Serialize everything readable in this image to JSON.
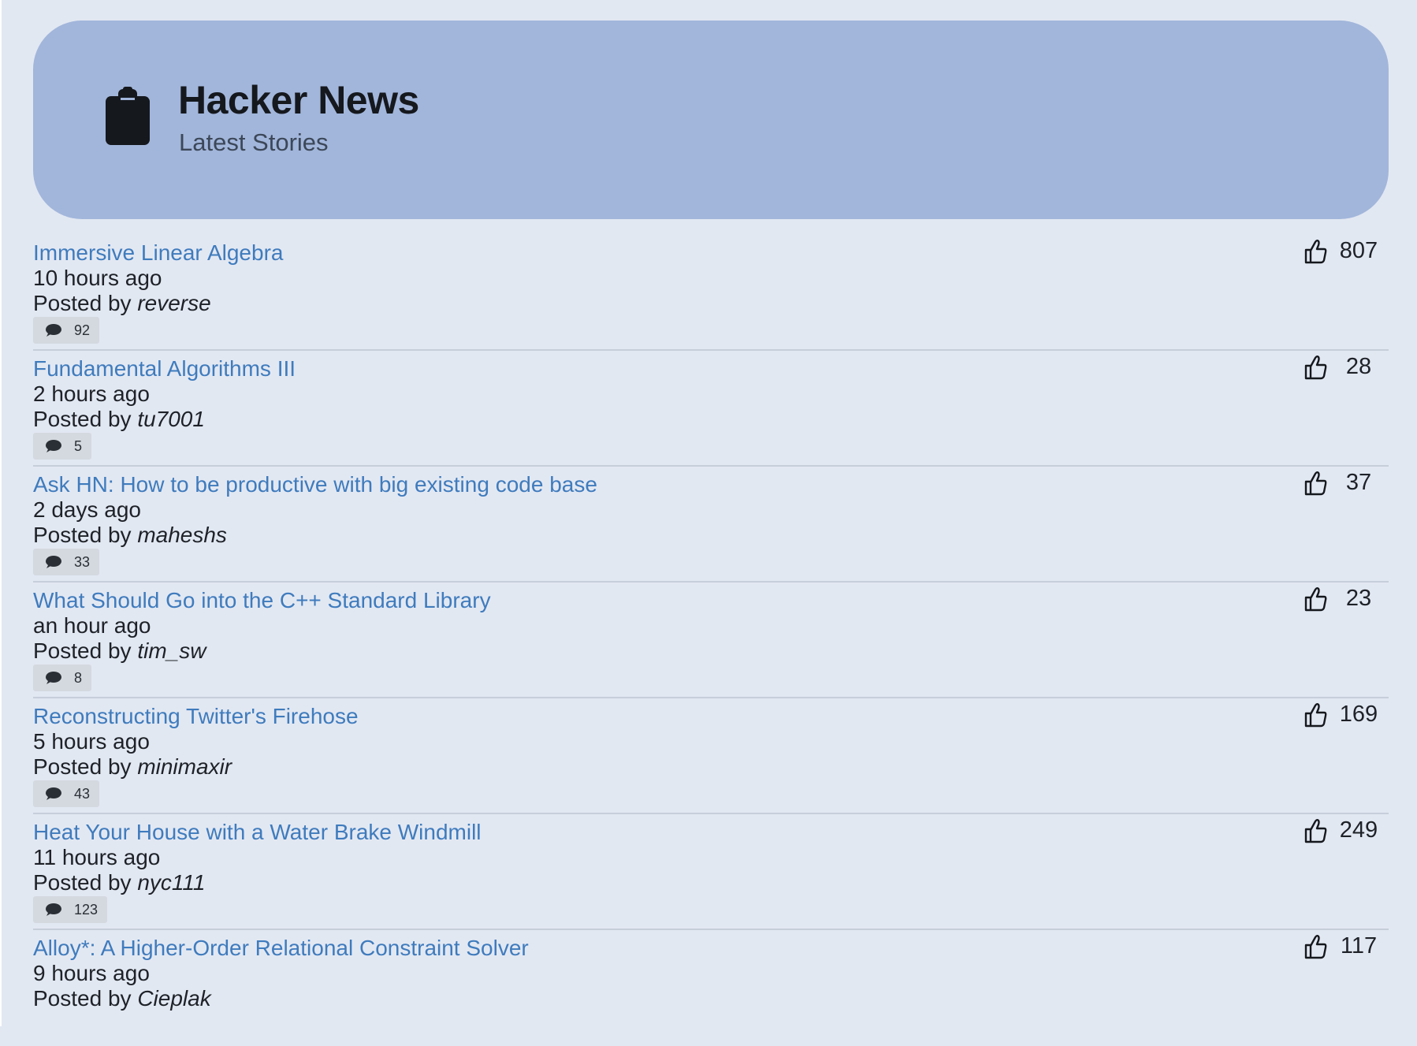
{
  "header": {
    "title": "Hacker News",
    "subtitle": "Latest Stories",
    "icon": "clipboard-icon",
    "background_color": "#a2b6db"
  },
  "colors": {
    "page_background": "#e2e8f2",
    "link": "#3f7bbd",
    "text": "#1e2228",
    "badge": "#d4d9e0"
  },
  "story_prefix": "Posted by",
  "stories": [
    {
      "title": "Immersive Linear Algebra",
      "time": "10 hours ago",
      "author": "reverse",
      "comments": "92",
      "points": "807"
    },
    {
      "title": "Fundamental Algorithms III",
      "time": "2 hours ago",
      "author": "tu7001",
      "comments": "5",
      "points": "28"
    },
    {
      "title": "Ask HN: How to be productive with big existing code base",
      "time": "2 days ago",
      "author": "maheshs",
      "comments": "33",
      "points": "37"
    },
    {
      "title": "What Should Go into the C++ Standard Library",
      "time": "an hour ago",
      "author": "tim_sw",
      "comments": "8",
      "points": "23"
    },
    {
      "title": "Reconstructing Twitter's Firehose",
      "time": "5 hours ago",
      "author": "minimaxir",
      "comments": "43",
      "points": "169"
    },
    {
      "title": "Heat Your House with a Water Brake Windmill",
      "time": "11 hours ago",
      "author": "nyc111",
      "comments": "123",
      "points": "249"
    },
    {
      "title": "Alloy*: A Higher-Order Relational Constraint Solver",
      "time": "9 hours ago",
      "author": "Cieplak",
      "comments": "",
      "points": "117"
    }
  ]
}
